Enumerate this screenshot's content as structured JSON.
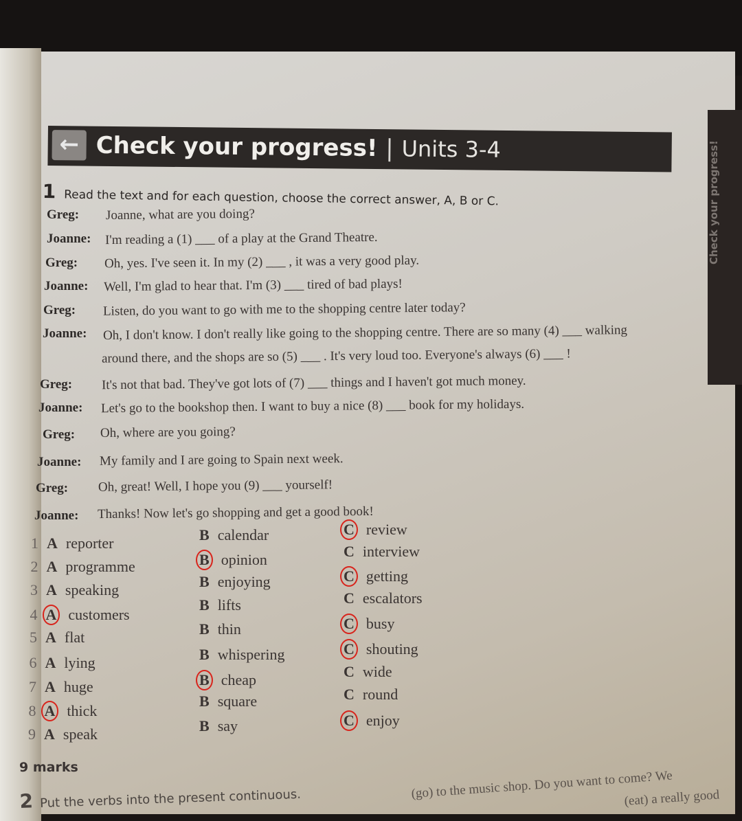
{
  "header": {
    "title": "Check your progress!",
    "separator": "|",
    "units": "Units 3-4",
    "back_icon": "arrow-left-icon"
  },
  "side_tab": "Check your progress!",
  "exercise1": {
    "number": "1",
    "instruction": "Read the text and for each question, choose the correct answer, A, B or C."
  },
  "dialogue": [
    {
      "speaker": "Greg:",
      "text": "Joanne, what are you doing?"
    },
    {
      "speaker": "Joanne:",
      "text": "I'm reading a (1) ___ of a play at the Grand Theatre."
    },
    {
      "speaker": "Greg:",
      "text": "Oh, yes. I've seen it. In my (2) ___ , it was a very good play."
    },
    {
      "speaker": "Joanne:",
      "text": "Well, I'm glad to hear that. I'm (3) ___ tired of bad plays!"
    },
    {
      "speaker": "Greg:",
      "text": "Listen, do you want to go with me to the shopping centre later today?"
    },
    {
      "speaker": "Joanne:",
      "text": "Oh, I don't know. I don't really like going to the shopping centre. There are so many (4) ___ walking"
    },
    {
      "speaker": "",
      "text": "around there, and the shops are so (5) ___ . It's very loud too. Everyone's always (6) ___ !"
    },
    {
      "speaker": "Greg:",
      "text": "It's not that bad. They've got lots of (7) ___ things and I haven't got much money."
    },
    {
      "speaker": "Joanne:",
      "text": "Let's go to the bookshop then. I want to buy a nice (8) ___ book for my holidays."
    },
    {
      "speaker": "Greg:",
      "text": "Oh, where are you going?"
    },
    {
      "speaker": "Joanne:",
      "text": "My family and I are going to Spain next week."
    },
    {
      "speaker": "Greg:",
      "text": "Oh, great! Well, I hope you (9) ___ yourself!"
    },
    {
      "speaker": "Joanne:",
      "text": "Thanks! Now let's go shopping and get a good book!"
    }
  ],
  "options": [
    {
      "n": "1",
      "a": "reporter",
      "b": "calendar",
      "c": "review",
      "circled": "C"
    },
    {
      "n": "2",
      "a": "programme",
      "b": "opinion",
      "c": "interview",
      "circled": "B"
    },
    {
      "n": "3",
      "a": "speaking",
      "b": "enjoying",
      "c": "getting",
      "circled": "C"
    },
    {
      "n": "4",
      "a": "customers",
      "b": "lifts",
      "c": "escalators",
      "circled": "A"
    },
    {
      "n": "5",
      "a": "flat",
      "b": "thin",
      "c": "busy",
      "circled": "C"
    },
    {
      "n": "6",
      "a": "lying",
      "b": "whispering",
      "c": "shouting",
      "circled": "C"
    },
    {
      "n": "7",
      "a": "huge",
      "b": "cheap",
      "c": "wide",
      "circled": "B"
    },
    {
      "n": "8",
      "a": "thick",
      "b": "square",
      "c": "round",
      "circled": "A"
    },
    {
      "n": "9",
      "a": "speak",
      "b": "say",
      "c": "enjoy",
      "circled": "C"
    }
  ],
  "marks": "9 marks",
  "exercise2": {
    "number": "2",
    "instruction": "Put the verbs into the present continuous.",
    "fragment1": "(go) to the music shop. Do you want to come? We",
    "fragment2": "(eat) a really good"
  },
  "colors": {
    "circle_mark": "#d8241c",
    "header_bg": "#2c2826"
  }
}
